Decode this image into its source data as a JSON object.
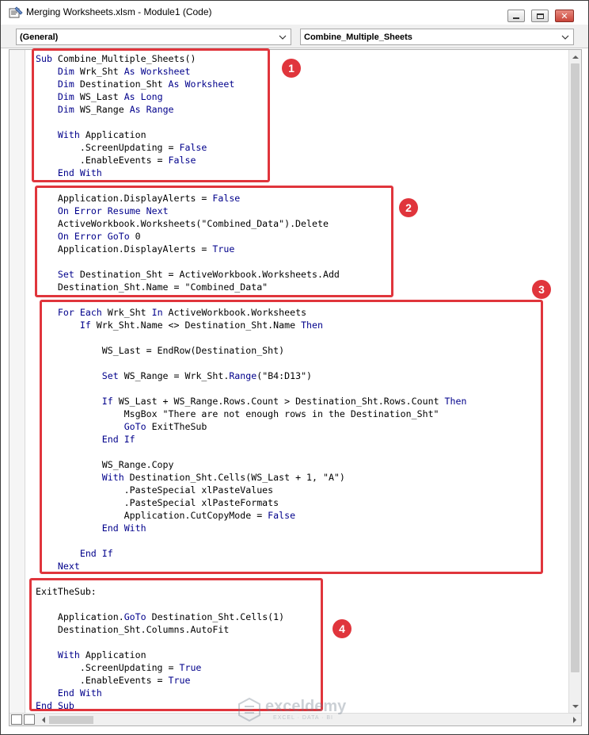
{
  "window": {
    "title": "Merging Worksheets.xlsm - Module1 (Code)",
    "min_icon": "minimize-icon",
    "max_icon": "maximize-icon",
    "close_icon": "close-icon"
  },
  "toolbar": {
    "object_combo": "(General)",
    "procedure_combo": "Combine_Multiple_Sheets"
  },
  "code_lines": [
    "Sub Combine_Multiple_Sheets()",
    "    Dim Wrk_Sht As Worksheet",
    "    Dim Destination_Sht As Worksheet",
    "    Dim WS_Last As Long",
    "    Dim WS_Range As Range",
    "",
    "    With Application",
    "        .ScreenUpdating = False",
    "        .EnableEvents = False",
    "    End With",
    "",
    "    Application.DisplayAlerts = False",
    "    On Error Resume Next",
    "    ActiveWorkbook.Worksheets(\"Combined_Data\").Delete",
    "    On Error GoTo 0",
    "    Application.DisplayAlerts = True",
    "",
    "    Set Destination_Sht = ActiveWorkbook.Worksheets.Add",
    "    Destination_Sht.Name = \"Combined_Data\"",
    "",
    "    For Each Wrk_Sht In ActiveWorkbook.Worksheets",
    "        If Wrk_Sht.Name <> Destination_Sht.Name Then",
    "",
    "            WS_Last = EndRow(Destination_Sht)",
    "",
    "            Set WS_Range = Wrk_Sht.Range(\"B4:D13\")",
    "",
    "            If WS_Last + WS_Range.Rows.Count > Destination_Sht.Rows.Count Then",
    "                MsgBox \"There are not enough rows in the Destination_Sht\"",
    "                GoTo ExitTheSub",
    "            End If",
    "",
    "            WS_Range.Copy",
    "            With Destination_Sht.Cells(WS_Last + 1, \"A\")",
    "                .PasteSpecial xlPasteValues",
    "                .PasteSpecial xlPasteFormats",
    "                Application.CutCopyMode = False",
    "            End With",
    "",
    "        End If",
    "    Next",
    "",
    "ExitTheSub:",
    "",
    "    Application.GoTo Destination_Sht.Cells(1)",
    "    Destination_Sht.Columns.AutoFit",
    "",
    "    With Application",
    "        .ScreenUpdating = True",
    "        .EnableEvents = True",
    "    End With",
    "End Sub"
  ],
  "keywords": [
    "Sub",
    "Dim",
    "As",
    "Worksheet",
    "Long",
    "Range",
    "With",
    "False",
    "True",
    "End",
    "On",
    "Error",
    "Resume",
    "Next",
    "GoTo",
    "Set",
    "For",
    "Each",
    "In",
    "If",
    "Then"
  ],
  "callouts": [
    "1",
    "2",
    "3",
    "4"
  ],
  "watermark": {
    "name": "exceldemy",
    "tagline": "EXCEL · DATA · BI"
  },
  "colors": {
    "keyword": "#00008b",
    "callout": "#e0353c"
  }
}
